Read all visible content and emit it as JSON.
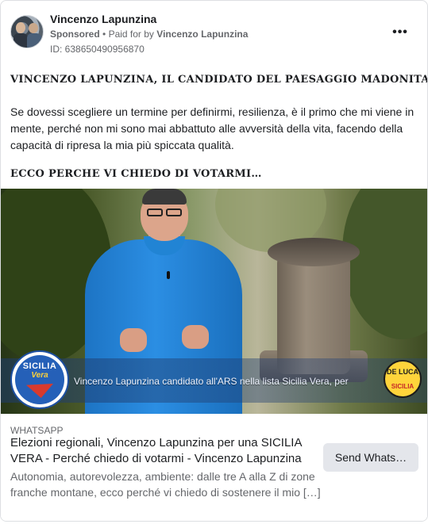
{
  "post": {
    "page_name": "Vincenzo Lapunzina",
    "sponsored_label": "Sponsored",
    "separator": "•",
    "paid_for_prefix": "Paid for by",
    "paid_for_name": "Vincenzo Lapunzina",
    "ad_id": "ID: 638650490956870",
    "more_icon_glyph": "•••",
    "headline_1": "VINCENZO LAPUNZINA, IL CANDIDATO DEL PAESAGGIO MADONITA",
    "body": "Se dovessi scegliere un termine per definirmi, resilienza, è il primo che mi viene in mente, perché non mi sono mai abbattuto alle avversità della vita, facendo della capacità di ripresa la mia più spiccata qualità.",
    "headline_2": "ECCO PERCHE VI CHIEDO DI VOTARMI…"
  },
  "media": {
    "caption": "Vincenzo Lapunzina candidato all'ARS nella lista Sicilia Vera, per",
    "logo_left_line1": "SICILIA",
    "logo_left_line2": "Vera",
    "logo_right_line1": "DE LUCA",
    "logo_right_line2": "SICILIA"
  },
  "link": {
    "source": "WHATSAPP",
    "title": "Elezioni regionali, Vincenzo Lapunzina per una SICILIA VERA - Perché chiedo di votarmi - Vincenzo Lapunzina",
    "description": "Autonomia, autorevolezza, ambiente: dalle tre A alla Z di zone franche montane, ecco perché vi chiedo di sostenere il mio […]",
    "cta_label": "Send Whats…"
  },
  "colors": {
    "shirt": "#2b8ee3",
    "caption_bar": "#1e3c6e",
    "logo_blue": "#2560b8",
    "logo_yellow": "#ffd43b",
    "cta_bg": "#e4e6eb"
  },
  "icons": {
    "more": "more-options-icon",
    "avatar": "profile-avatar"
  }
}
